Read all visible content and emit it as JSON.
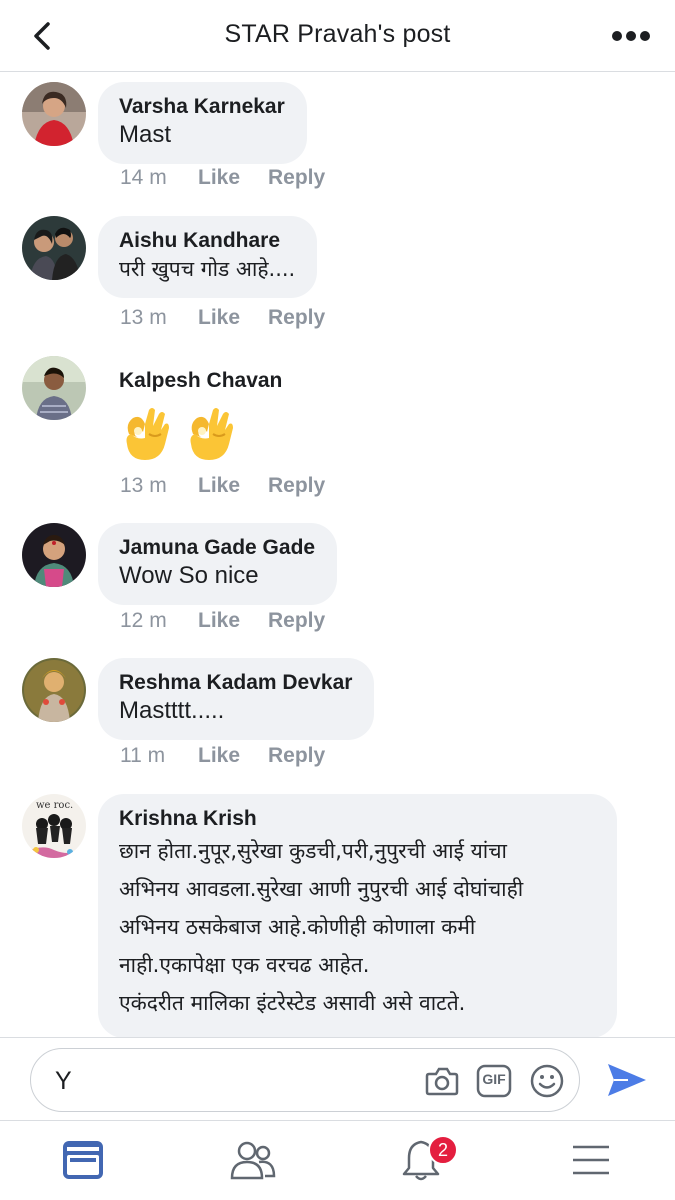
{
  "header": {
    "title": "STAR Pravah's post",
    "back_icon": "chevron-left-icon",
    "more_icon": "more-dots-icon"
  },
  "comments": [
    {
      "author": "Varsha Karnekar",
      "text": "Mast",
      "time": "14 m",
      "like": "Like",
      "reply": "Reply"
    },
    {
      "author": "Aishu Kandhare",
      "text": "परी खुपच गोड आहे....",
      "time": "13 m",
      "like": "Like",
      "reply": "Reply"
    },
    {
      "author": "Kalpesh Chavan",
      "text": "👌👌",
      "time": "13 m",
      "like": "Like",
      "reply": "Reply"
    },
    {
      "author": "Jamuna Gade Gade",
      "text": "Wow So nice",
      "time": "12 m",
      "like": "Like",
      "reply": "Reply"
    },
    {
      "author": "Reshma Kadam Devkar",
      "text": "Mastttt.....",
      "time": "11 m",
      "like": "Like",
      "reply": "Reply"
    },
    {
      "author": "Krishna Krish",
      "text": "छान होता.नुपूर,सुरेखा कुडची,परी,नुपुरची आई यांचा\nअभिनय आवडला.सुरेखा आणी नुपुरची आई दोघांचाही\nअभिनय ठसकेबाज आहे.कोणीही कोणाला कमी\nनाही.एकापेक्षा एक वरचढ आहेत.\nएकंदरीत मालिका इंटरेस्टेड असावी असे वाटते.",
      "avatar_text": "we roc."
    }
  ],
  "composer": {
    "value": "Y",
    "icons": [
      "camera-icon",
      "gif-icon",
      "emoji-icon",
      "send-icon"
    ],
    "gif_label": "GIF"
  },
  "bottom_nav": {
    "items": [
      "news-feed-icon",
      "friends-icon",
      "notifications-icon",
      "menu-icon"
    ],
    "notification_count": "2",
    "active_color": "#4267b2"
  }
}
